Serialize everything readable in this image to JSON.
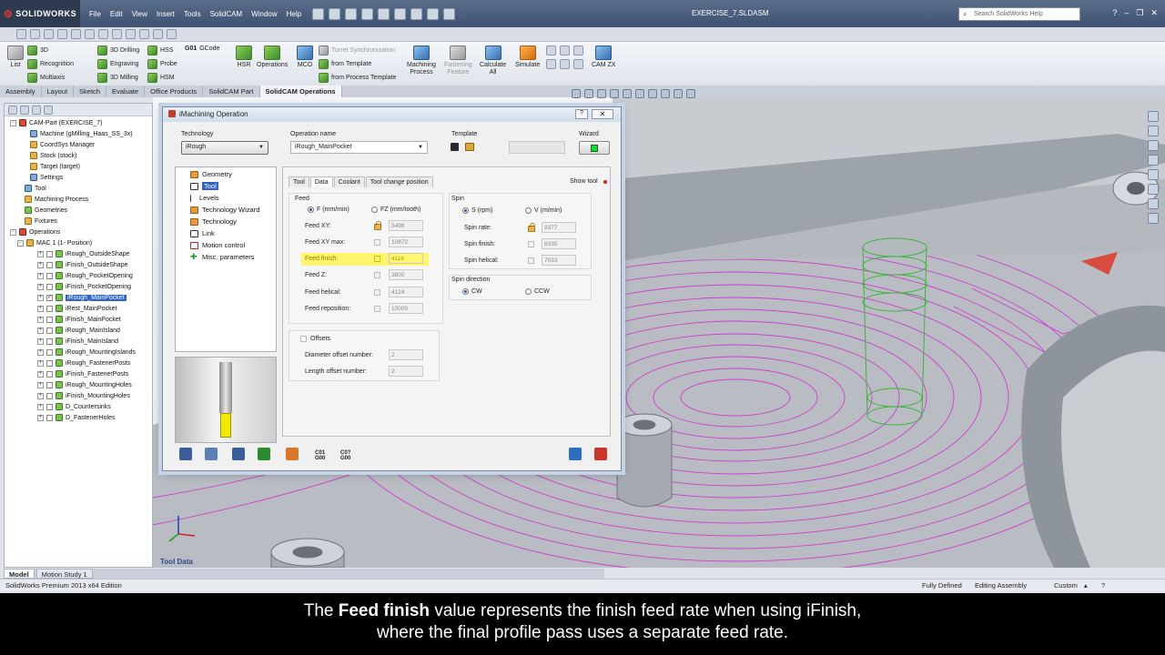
{
  "app": {
    "logo": "SOLIDWORKS",
    "menus": [
      "File",
      "Edit",
      "View",
      "Insert",
      "Tools",
      "SolidCAM",
      "Window",
      "Help"
    ],
    "document_title": "EXERCISE_7.SLDASM",
    "search_placeholder": "Search SolidWorks Help"
  },
  "command_manager": {
    "list_label": "List",
    "col1": [
      "3D",
      "Recognition",
      "Multiaxis"
    ],
    "col2": [
      "3D Drilling",
      "Engraving",
      "3D Milling"
    ],
    "col3": [
      "HSS",
      "Probe",
      "HSM"
    ],
    "gcode_prefix": "G01",
    "gcode_label": "GCode",
    "hsr": "HSR",
    "operations": "Operations",
    "mco": "MCO",
    "template_items": [
      "Turret Synchronization",
      "from Template",
      "from Process Template"
    ],
    "machining_process": [
      "Machining",
      "Process"
    ],
    "fastening_feature": [
      "Fastening",
      "Feature"
    ],
    "calculate_all": [
      "Calculate",
      "All"
    ],
    "simulate": "Simulate",
    "camzx": "CAM ZX"
  },
  "cm_tabs": [
    "Assembly",
    "Layout",
    "Sketch",
    "Evaluate",
    "Office Products",
    "SolidCAM Part",
    "SolidCAM Operations"
  ],
  "tree": {
    "items": [
      "CAM-Part (EXERCISE_7)",
      "Machine (gMilling_Haas_SS_3x)",
      "CoordSys Manager",
      "Stock (stock)",
      "Target (target)",
      "Settings",
      "Tool",
      "Machining Process",
      "Geometries",
      "Fixtures",
      "Operations",
      "MAC 1 (1- Position)"
    ],
    "operations": [
      "iRough_OutsideShape",
      "iFinish_OutsideShape",
      "iRough_PocketOpening",
      "iFinish_PocketOpening",
      "iRough_MainPocket",
      "iRest_MainPocket",
      "iFinish_MainPocket",
      "iRough_MainIsland",
      "iFinish_MainIsland",
      "iRough_MountingIslands",
      "iRough_FastenerPosts",
      "iFinish_FastenerPosts",
      "iRough_MountingHoles",
      "iFinish_MountingHoles",
      "D_Countersinks",
      "D_FastenerHoles"
    ]
  },
  "bottom_tabs": [
    "Model",
    "Motion Study 1"
  ],
  "status": {
    "edition": "SolidWorks Premium 2013 x64 Edition",
    "defined": "Fully Defined",
    "editing": "Editing Assembly",
    "custom": "Custom"
  },
  "viewport": {
    "tool_data_label": "Tool Data"
  },
  "dialog": {
    "title": "iMachining Operation",
    "technology_label": "Technology",
    "technology_value": "iRough",
    "opname_label": "Operation name",
    "opname_value": "iRough_MainPocket",
    "template_label": "Template",
    "wizard_label": "Wizard",
    "nav": [
      "Geometry",
      "Tool",
      "Levels",
      "Technology Wizard",
      "Technology",
      "Link",
      "Motion control",
      "Misc. parameters"
    ],
    "tabs": [
      "Tool",
      "Data",
      "Coolant",
      "Tool change position"
    ],
    "show_tool": "Show tool",
    "feed": {
      "title": "Feed",
      "radio_f": "F (mm/min)",
      "radio_fz": "FZ (mm/tooth)",
      "rows": [
        {
          "label": "Feed XY:",
          "value": "5498"
        },
        {
          "label": "Feed XY max:",
          "value": "10872"
        },
        {
          "label": "Feed finish:",
          "value": "4116"
        },
        {
          "label": "Feed Z:",
          "value": "3800"
        },
        {
          "label": "Feed helical:",
          "value": "4124"
        },
        {
          "label": "Feed reposition:",
          "value": "10000"
        }
      ]
    },
    "spin": {
      "title": "Spin",
      "radio_s": "S (rpm)",
      "radio_v": "V (m/min)",
      "rows": [
        {
          "label": "Spin rate:",
          "value": "9377"
        },
        {
          "label": "Spin finish:",
          "value": "8335"
        },
        {
          "label": "Spin helical:",
          "value": "7033"
        }
      ],
      "direction_title": "Spin direction",
      "cw": "CW",
      "ccw": "CCW"
    },
    "offsets": {
      "title": "Offsets",
      "diameter_label": "Diameter offset number:",
      "diameter_value": "2",
      "length_label": "Length offset number:",
      "length_value": "2"
    },
    "gcode1": [
      "C01",
      "G00"
    ],
    "gcode2": [
      "C0?",
      "G00"
    ]
  },
  "subtitle": {
    "line1_pre": "The ",
    "line1_bold": "Feed finish",
    "line1_post": " value represents the finish feed rate when using iFinish,",
    "line2": "where the final profile pass uses a separate feed rate."
  },
  "colors": {
    "highlight": "#fff66e",
    "selection": "#2f63c8",
    "toolpath": "#d12ad1"
  }
}
